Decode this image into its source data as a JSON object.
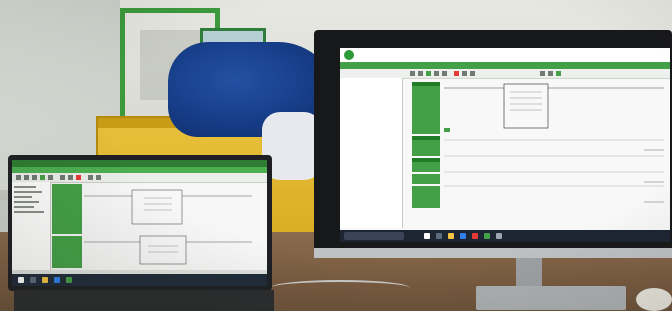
{
  "scene": {
    "description_label": "",
    "colors": {
      "software_green": "#43a047",
      "rack_green": "#3c9a3c",
      "yellow_panel": "#e0b52a",
      "bag_blue": "#163c86"
    }
  },
  "laptop": {
    "window_title": "",
    "menu_items": [],
    "rung_labels": [
      "",
      ""
    ]
  },
  "monitor": {
    "window_title": "",
    "menu_items": [],
    "sidebar_items": [
      "",
      "",
      "",
      "",
      "",
      "",
      "",
      ""
    ],
    "rung_labels": [
      "",
      "",
      "",
      "",
      ""
    ]
  },
  "icons": {
    "laptop_taskbar": [
      "start-icon",
      "search-icon",
      "folder-icon",
      "browser-icon",
      "app-icon"
    ],
    "monitor_taskbar": [
      "start-icon",
      "search-icon",
      "folder-icon",
      "browser-icon",
      "mail-icon",
      "app-icon",
      "settings-icon"
    ]
  }
}
